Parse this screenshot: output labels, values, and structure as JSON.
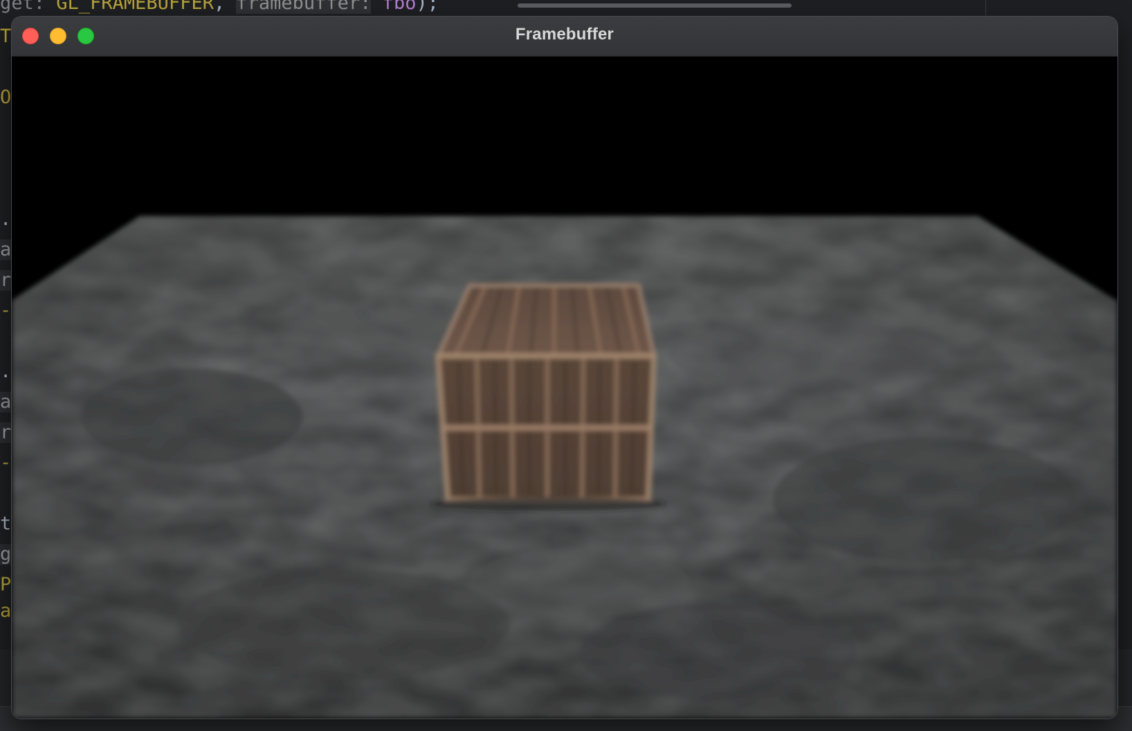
{
  "editor": {
    "top_line": {
      "prefix": "get: ",
      "const": "GL_FRAMEBUFFER",
      "sep": ", ",
      "param_label": "framebuffer:",
      "value": " fbo",
      "suffix": ");"
    },
    "gutter_fragments": [
      {
        "text": "TH",
        "kind": "kw"
      },
      {
        "text": "OR",
        "kind": "kw"
      },
      {
        "text": ".f",
        "kind": "plain"
      },
      {
        "text": "a",
        "kind": "hl"
      },
      {
        "text": "re",
        "kind": "hl"
      },
      {
        "text": "--",
        "kind": "kw"
      },
      {
        "text": ".f",
        "kind": "plain"
      },
      {
        "text": "a",
        "kind": "hl"
      },
      {
        "text": "re",
        "kind": "hl"
      },
      {
        "text": "--",
        "kind": "kw"
      },
      {
        "text": "t",
        "kind": "plain"
      },
      {
        "text": "g",
        "kind": "hl"
      },
      {
        "text": "PT",
        "kind": "kw"
      },
      {
        "text": "ar",
        "kind": "kw"
      }
    ]
  },
  "window": {
    "title": "Framebuffer",
    "controls": {
      "close_color": "#ff5f57",
      "minimize_color": "#febc2e",
      "maximize_color": "#28c840"
    }
  },
  "scene": {
    "description_colors": {
      "sky": "#000000",
      "floor": "#4a4b4b",
      "crate": "#6b5446"
    }
  }
}
